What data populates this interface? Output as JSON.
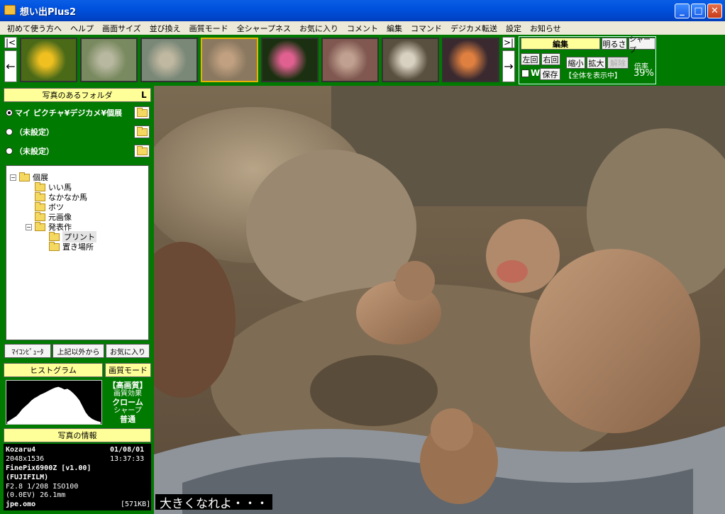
{
  "window": {
    "title": "想い出Plus2",
    "controls": [
      "_",
      "□",
      "✕"
    ]
  },
  "menu": [
    "初めて使う方へ",
    "ヘルプ",
    "画面サイズ",
    "並び換え",
    "画質モード",
    "全シャープネス",
    "お気に入り",
    "コメント",
    "編集",
    "コマンド",
    "デジカメ転送",
    "設定",
    "お知らせ"
  ],
  "nav": {
    "first": "|<",
    "last": ">|",
    "prev": "←",
    "next": "→"
  },
  "thumbnails": [
    {
      "name": "yellow-flower",
      "color": "#4a6a18",
      "accent": "#f0c020"
    },
    {
      "name": "grass-field",
      "color": "#7a8a60",
      "accent": "#b8b8a0"
    },
    {
      "name": "ducks",
      "color": "#7a8878",
      "accent": "#c0b8a0"
    },
    {
      "name": "monkeys",
      "color": "#8a7860",
      "accent": "#c0a080",
      "selected": true
    },
    {
      "name": "pink-flower",
      "color": "#1a3010",
      "accent": "#e06090"
    },
    {
      "name": "horse-park",
      "color": "#805850",
      "accent": "#c0a090"
    },
    {
      "name": "cow",
      "color": "#5a5040",
      "accent": "#d8d0c0"
    },
    {
      "name": "sunset-sky",
      "color": "#3a2a30",
      "accent": "#e08040"
    }
  ],
  "edit_panel": {
    "edit_label": "編集",
    "brightness": "明るさ",
    "sharp": "シャープ",
    "rotate_left": "左回",
    "rotate_right": "右回",
    "shrink": "縮小",
    "enlarge": "拡大",
    "release": "解除",
    "zoom_label": "倍率",
    "w_label": "W",
    "save": "保存",
    "fit_status": "【全体を表示中】",
    "zoom_value": "39%"
  },
  "folders": {
    "header": "写真のあるフォルダ",
    "corner_letter": "L",
    "rows": [
      {
        "label": "マイ ピクチャ¥デジカメ¥個展",
        "selected": true
      },
      {
        "label": "（未設定）",
        "selected": false
      },
      {
        "label": "（未設定）",
        "selected": false
      }
    ]
  },
  "tree": {
    "root": "個展",
    "children": [
      "いい馬",
      "なかなか馬",
      "ボツ",
      "元画像"
    ],
    "group": "発表作",
    "group_children": [
      "プリント",
      "置き場所"
    ],
    "selected": "プリント"
  },
  "folder_buttons": [
    "ﾏｲｺﾝﾋﾟｭｰﾀ",
    "上記以外から",
    "お気に入り"
  ],
  "histogram": {
    "label": "ヒストグラム",
    "values": [
      0.05,
      0.1,
      0.15,
      0.2,
      0.28,
      0.38,
      0.45,
      0.52,
      0.6,
      0.66,
      0.7,
      0.75,
      0.78,
      0.82,
      0.86,
      0.9,
      0.93,
      0.95,
      0.92,
      0.88,
      0.9,
      0.85,
      0.78,
      0.7,
      0.6,
      0.45,
      0.3,
      0.2,
      0.14,
      0.1,
      0.07,
      0.05
    ]
  },
  "quality": {
    "label": "画質モード",
    "mode": "【高画質】",
    "effect_label": "画質効果",
    "effect": "クローム",
    "sharp_label": "シャープ",
    "sharp": "普通"
  },
  "info": {
    "label": "写真の情報",
    "name": "Kozaru4",
    "date": "01/08/01",
    "size": "2048x1536",
    "time": "13:37:33",
    "camera": "FinePix6900Z [v1.00]",
    "maker": "(FUJIFILM)",
    "exposure": "F2.8 1/208 ISO100",
    "ev": "(0.0EV) 26.1mm",
    "filename": "jpe.omo",
    "filesize": "[571KB]"
  },
  "caption": "大きくなれよ・・・"
}
